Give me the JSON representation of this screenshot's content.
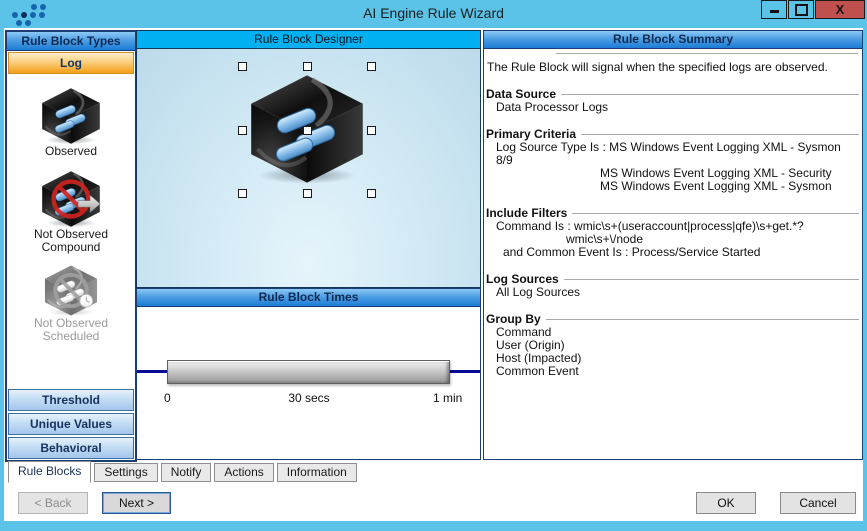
{
  "window": {
    "title": "AI Engine Rule Wizard",
    "controls": {
      "close": "X"
    }
  },
  "icons": {
    "logo": "logrhythm-dots-logo",
    "minimize": "minimize-icon",
    "maximize": "maximize-icon",
    "close": "close-icon",
    "observed": "observed-cube-icon",
    "not_observed_compound": "not-observed-compound-cube-icon",
    "not_observed_scheduled": "not-observed-scheduled-cube-icon",
    "designer_cube": "rule-block-cube",
    "selection_handle": "selection-handle"
  },
  "colors": {
    "titlebar": "#5cc3e8",
    "accent_cyan": "#00b0f0",
    "header_gradient_top": "#8cc9f5",
    "header_gradient_bottom": "#1b7cd6",
    "log_selected_top": "#fdeccb",
    "log_selected_bottom": "#f4a01a",
    "close_button": "#c0504d",
    "slider_track": "#0a0a99",
    "panel_border": "#1c3e74"
  },
  "rule_block_types": {
    "header": "Rule Block Types",
    "selected_category": "Log",
    "items": [
      {
        "label": "Observed"
      },
      {
        "label_line1": "Not Observed",
        "label_line2": "Compound"
      },
      {
        "label_line1": "Not Observed",
        "label_line2": "Scheduled",
        "disabled": true
      }
    ],
    "categories": [
      "Threshold",
      "Unique Values",
      "Behavioral"
    ]
  },
  "designer": {
    "header": "Rule Block Designer"
  },
  "times": {
    "header": "Rule Block Times",
    "ticks": [
      "0",
      "30 secs",
      "1 min"
    ]
  },
  "summary": {
    "header": "Rule Block Summary",
    "intro": "The Rule Block will signal when the specified logs are observed.",
    "data_source": {
      "title": "Data Source",
      "items": [
        "Data Processor Logs"
      ]
    },
    "primary_criteria": {
      "title": "Primary Criteria",
      "items": [
        "Log Source Type Is : MS Windows Event Logging XML - Sysmon 8/9",
        "MS Windows Event Logging XML - Security",
        "MS Windows Event Logging XML - Sysmon"
      ]
    },
    "include_filters": {
      "title": "Include Filters",
      "items": [
        "Command Is : wmic\\s+(useraccount|process|qfe)\\s+get.*?",
        "wmic\\s+\\/node",
        "and Common Event Is : Process/Service Started"
      ]
    },
    "log_sources": {
      "title": "Log Sources",
      "items": [
        "All Log Sources"
      ]
    },
    "group_by": {
      "title": "Group By",
      "items": [
        "Command",
        "User (Origin)",
        "Host (Impacted)",
        "Common Event"
      ]
    }
  },
  "tabs": {
    "items": [
      {
        "label": "Rule Blocks",
        "active": true
      },
      {
        "label": "Settings"
      },
      {
        "label": "Notify"
      },
      {
        "label": "Actions"
      },
      {
        "label": "Information"
      }
    ]
  },
  "footer": {
    "back": "< Back",
    "next": "Next >",
    "ok": "OK",
    "cancel": "Cancel"
  }
}
